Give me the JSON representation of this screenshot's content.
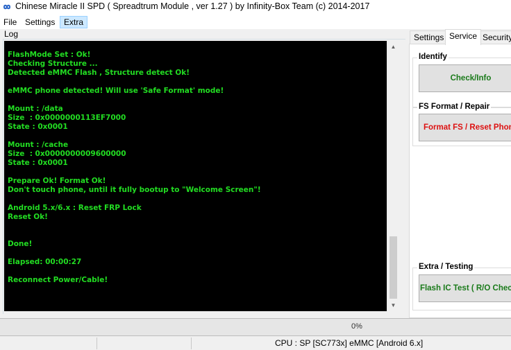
{
  "window": {
    "title": "Chinese Miracle II SPD ( Spreadtrum Module , ver 1.27 ) by Infinity-Box Team (c) 2014-2017",
    "icon": "infinity-logo-icon"
  },
  "menu": {
    "items": [
      "File",
      "Settings",
      "Extra"
    ],
    "active": "Extra"
  },
  "log": {
    "label": "Log",
    "lines": [
      "FlashMode Set : Ok!",
      "Checking Structure ...",
      "Detected eMMC Flash , Structure detect Ok!",
      "",
      "eMMC phone detected! Will use 'Safe Format' mode!",
      "",
      "Mount : /data",
      "Size  : 0x0000000113EF7000",
      "State : 0x0001",
      "",
      "Mount : /cache",
      "Size  : 0x0000000009600000",
      "State : 0x0001",
      "",
      "Prepare Ok! Format Ok!",
      "Don't touch phone, until it fully bootup to \"Welcome Screen\"!",
      "",
      "Android 5.x/6.x : Reset FRP Lock",
      "Reset Ok!",
      "",
      "",
      "Done!",
      "",
      "Elapsed: 00:00:27",
      "",
      "Reconnect Power/Cable!"
    ],
    "text_color": "#22dd22",
    "background": "#000000"
  },
  "tabs": {
    "items": [
      "Settings",
      "Service",
      "Security"
    ],
    "active": "Service"
  },
  "service": {
    "identify": {
      "title": "Identify",
      "button": "Check/Info"
    },
    "fs": {
      "title": "FS Format / Repair",
      "button": "Format FS / Reset Phone"
    },
    "extra": {
      "title": "Extra / Testing",
      "button": "Flash IC Test ( R/O Check )"
    }
  },
  "progress": {
    "value": 0,
    "label": "0%"
  },
  "status": {
    "cpu": "CPU : SP [SC773x] eMMC [Android 6.x]"
  },
  "colors": {
    "green_button_text": "#1a7a1a",
    "red_button_text": "#dd1111"
  }
}
